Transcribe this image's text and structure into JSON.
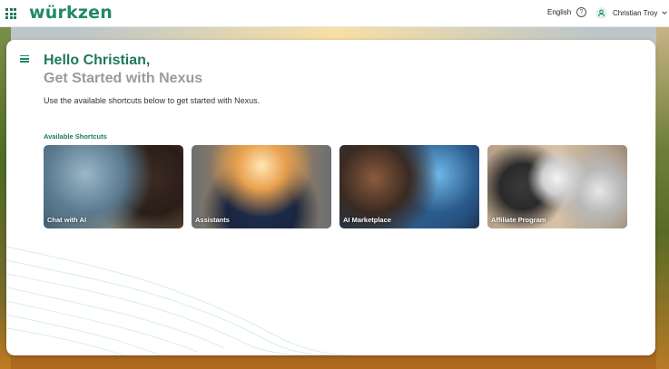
{
  "app": {
    "logo_text": "würkzen",
    "language": "English",
    "user_name": "Christian Troy",
    "accent": "#1f7a5a"
  },
  "icons": {
    "apps": "apps-grid-icon",
    "help": "help-circle-icon",
    "user": "user-icon",
    "chevron": "chevron-down-icon",
    "menu": "menu-icon"
  },
  "main": {
    "greeting": "Hello Christian,",
    "subtitle": "Get Started with Nexus",
    "description": "Use the available shortcuts below to get started with Nexus.",
    "section_title": "Available Shortcuts",
    "shortcuts": [
      {
        "label": "Chat with AI"
      },
      {
        "label": "Assistants"
      },
      {
        "label": "AI Marketplace"
      },
      {
        "label": "Affiliate Program"
      }
    ]
  }
}
